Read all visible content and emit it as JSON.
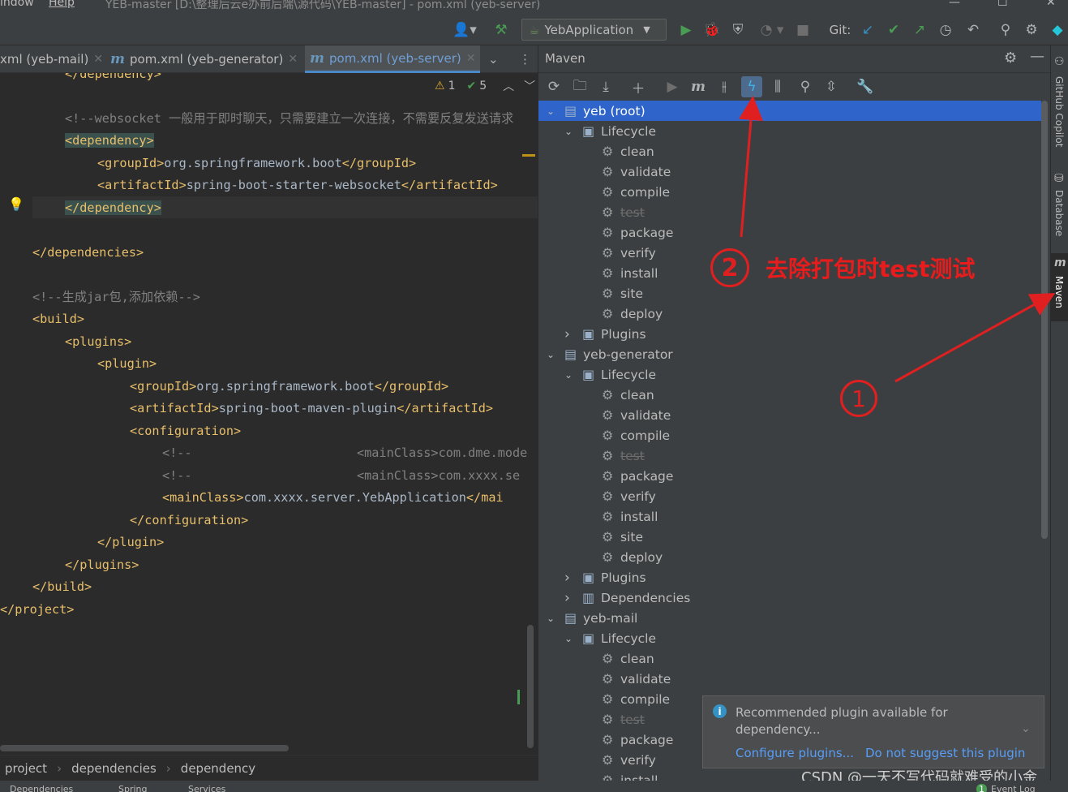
{
  "titlebar": {
    "menu_window": "indow",
    "menu_help": "Help",
    "title": "YEB-master [D:\\整理后云e办前后端\\源代码\\YEB-master] - pom.xml (yeb-server)",
    "min": "—",
    "max": "☐",
    "close": "✕"
  },
  "toolbar": {
    "run_config": "YebApplication",
    "git_label": "Git:"
  },
  "tabs": [
    {
      "label": "xml (yeb-mail)",
      "close": "✕"
    },
    {
      "label": "pom.xml (yeb-generator)",
      "close": "✕"
    },
    {
      "label": "pom.xml (yeb-server)",
      "close": "✕"
    }
  ],
  "editor": {
    "warnings": "1",
    "oks": "5",
    "lines": {
      "l0": "</dependency>",
      "l1_comment": "<!--websocket 一般用于即时聊天，只需要建立一次连接，不需要反复发送请求",
      "l2": "<dependency>",
      "l3_a": "<groupId>",
      "l3_b": "org.springframework.boot",
      "l3_c": "</groupId>",
      "l4_a": "<artifactId>",
      "l4_b": "spring-boot-starter-websocket",
      "l4_c": "</artifactId>",
      "l5": "</dependency>",
      "l6": "</dependencies>",
      "l7_comment": "<!--生成jar包,添加依赖-->",
      "l8": "<build>",
      "l9": "<plugins>",
      "l10": "<plugin>",
      "l11_a": "<groupId>",
      "l11_b": "org.springframework.boot",
      "l11_c": "</groupId>",
      "l12_a": "<artifactId>",
      "l12_b": "spring-boot-maven-plugin",
      "l12_c": "</artifactId>",
      "l13": "<configuration>",
      "l14_a": "<!--",
      "l14_b": "<mainClass>com.dme.mode",
      "l15_a": "<!--",
      "l15_b": "<mainClass>com.xxxx.se",
      "l16_a": "<mainClass>",
      "l16_b": "com.xxxx.server.YebApplication",
      "l16_c": "</mai",
      "l17": "</configuration>",
      "l18": "</plugin>",
      "l19": "</plugins>",
      "l20": "</build>",
      "l21": "</project>"
    }
  },
  "breadcrumb": [
    "project",
    "dependencies",
    "dependency"
  ],
  "maven": {
    "title": "Maven",
    "tree": [
      {
        "label": "yeb (root)",
        "level": 0,
        "kind": "module",
        "expanded": true,
        "selected": true
      },
      {
        "label": "Lifecycle",
        "level": 1,
        "kind": "folder",
        "expanded": true
      },
      {
        "label": "clean",
        "level": 2,
        "kind": "goal"
      },
      {
        "label": "validate",
        "level": 2,
        "kind": "goal"
      },
      {
        "label": "compile",
        "level": 2,
        "kind": "goal"
      },
      {
        "label": "test",
        "level": 2,
        "kind": "goal",
        "skipped": true
      },
      {
        "label": "package",
        "level": 2,
        "kind": "goal"
      },
      {
        "label": "verify",
        "level": 2,
        "kind": "goal"
      },
      {
        "label": "install",
        "level": 2,
        "kind": "goal"
      },
      {
        "label": "site",
        "level": 2,
        "kind": "goal"
      },
      {
        "label": "deploy",
        "level": 2,
        "kind": "goal"
      },
      {
        "label": "Plugins",
        "level": 1,
        "kind": "folder",
        "expanded": false
      },
      {
        "label": "yeb-generator",
        "level": 0,
        "kind": "module",
        "expanded": true
      },
      {
        "label": "Lifecycle",
        "level": 1,
        "kind": "folder",
        "expanded": true
      },
      {
        "label": "clean",
        "level": 2,
        "kind": "goal"
      },
      {
        "label": "validate",
        "level": 2,
        "kind": "goal"
      },
      {
        "label": "compile",
        "level": 2,
        "kind": "goal"
      },
      {
        "label": "test",
        "level": 2,
        "kind": "goal",
        "skipped": true
      },
      {
        "label": "package",
        "level": 2,
        "kind": "goal"
      },
      {
        "label": "verify",
        "level": 2,
        "kind": "goal"
      },
      {
        "label": "install",
        "level": 2,
        "kind": "goal"
      },
      {
        "label": "site",
        "level": 2,
        "kind": "goal"
      },
      {
        "label": "deploy",
        "level": 2,
        "kind": "goal"
      },
      {
        "label": "Plugins",
        "level": 1,
        "kind": "folder",
        "expanded": false
      },
      {
        "label": "Dependencies",
        "level": 1,
        "kind": "deps",
        "expanded": false
      },
      {
        "label": "yeb-mail",
        "level": 0,
        "kind": "module",
        "expanded": true
      },
      {
        "label": "Lifecycle",
        "level": 1,
        "kind": "folder",
        "expanded": true
      },
      {
        "label": "clean",
        "level": 2,
        "kind": "goal"
      },
      {
        "label": "validate",
        "level": 2,
        "kind": "goal"
      },
      {
        "label": "compile",
        "level": 2,
        "kind": "goal"
      },
      {
        "label": "test",
        "level": 2,
        "kind": "goal",
        "skipped": true
      },
      {
        "label": "package",
        "level": 2,
        "kind": "goal"
      },
      {
        "label": "verify",
        "level": 2,
        "kind": "goal"
      },
      {
        "label": "install",
        "level": 2,
        "kind": "goal"
      }
    ]
  },
  "right_strip": {
    "copilot": "GitHub Copilot",
    "database": "Database",
    "maven": "Maven"
  },
  "notification": {
    "text": "Recommended plugin available for dependency...",
    "configure": "Configure plugins...",
    "dismiss": "Do not suggest this plugin"
  },
  "annotations": {
    "step1_number": "1",
    "step2_number": "2",
    "step2_text": "去除打包时test测试"
  },
  "watermark": "CSDN @一天不写代码就难受的小金",
  "bottombar": {
    "dependencies": "Dependencies",
    "spring": "Spring",
    "services": "Services",
    "event_log": "Event Log",
    "event_count": "1"
  },
  "colors": {
    "accent_blue": "#2f65ca",
    "annotation_red": "#e02020",
    "xml_tag": "#e8bf6a",
    "run_green": "#499c54"
  }
}
